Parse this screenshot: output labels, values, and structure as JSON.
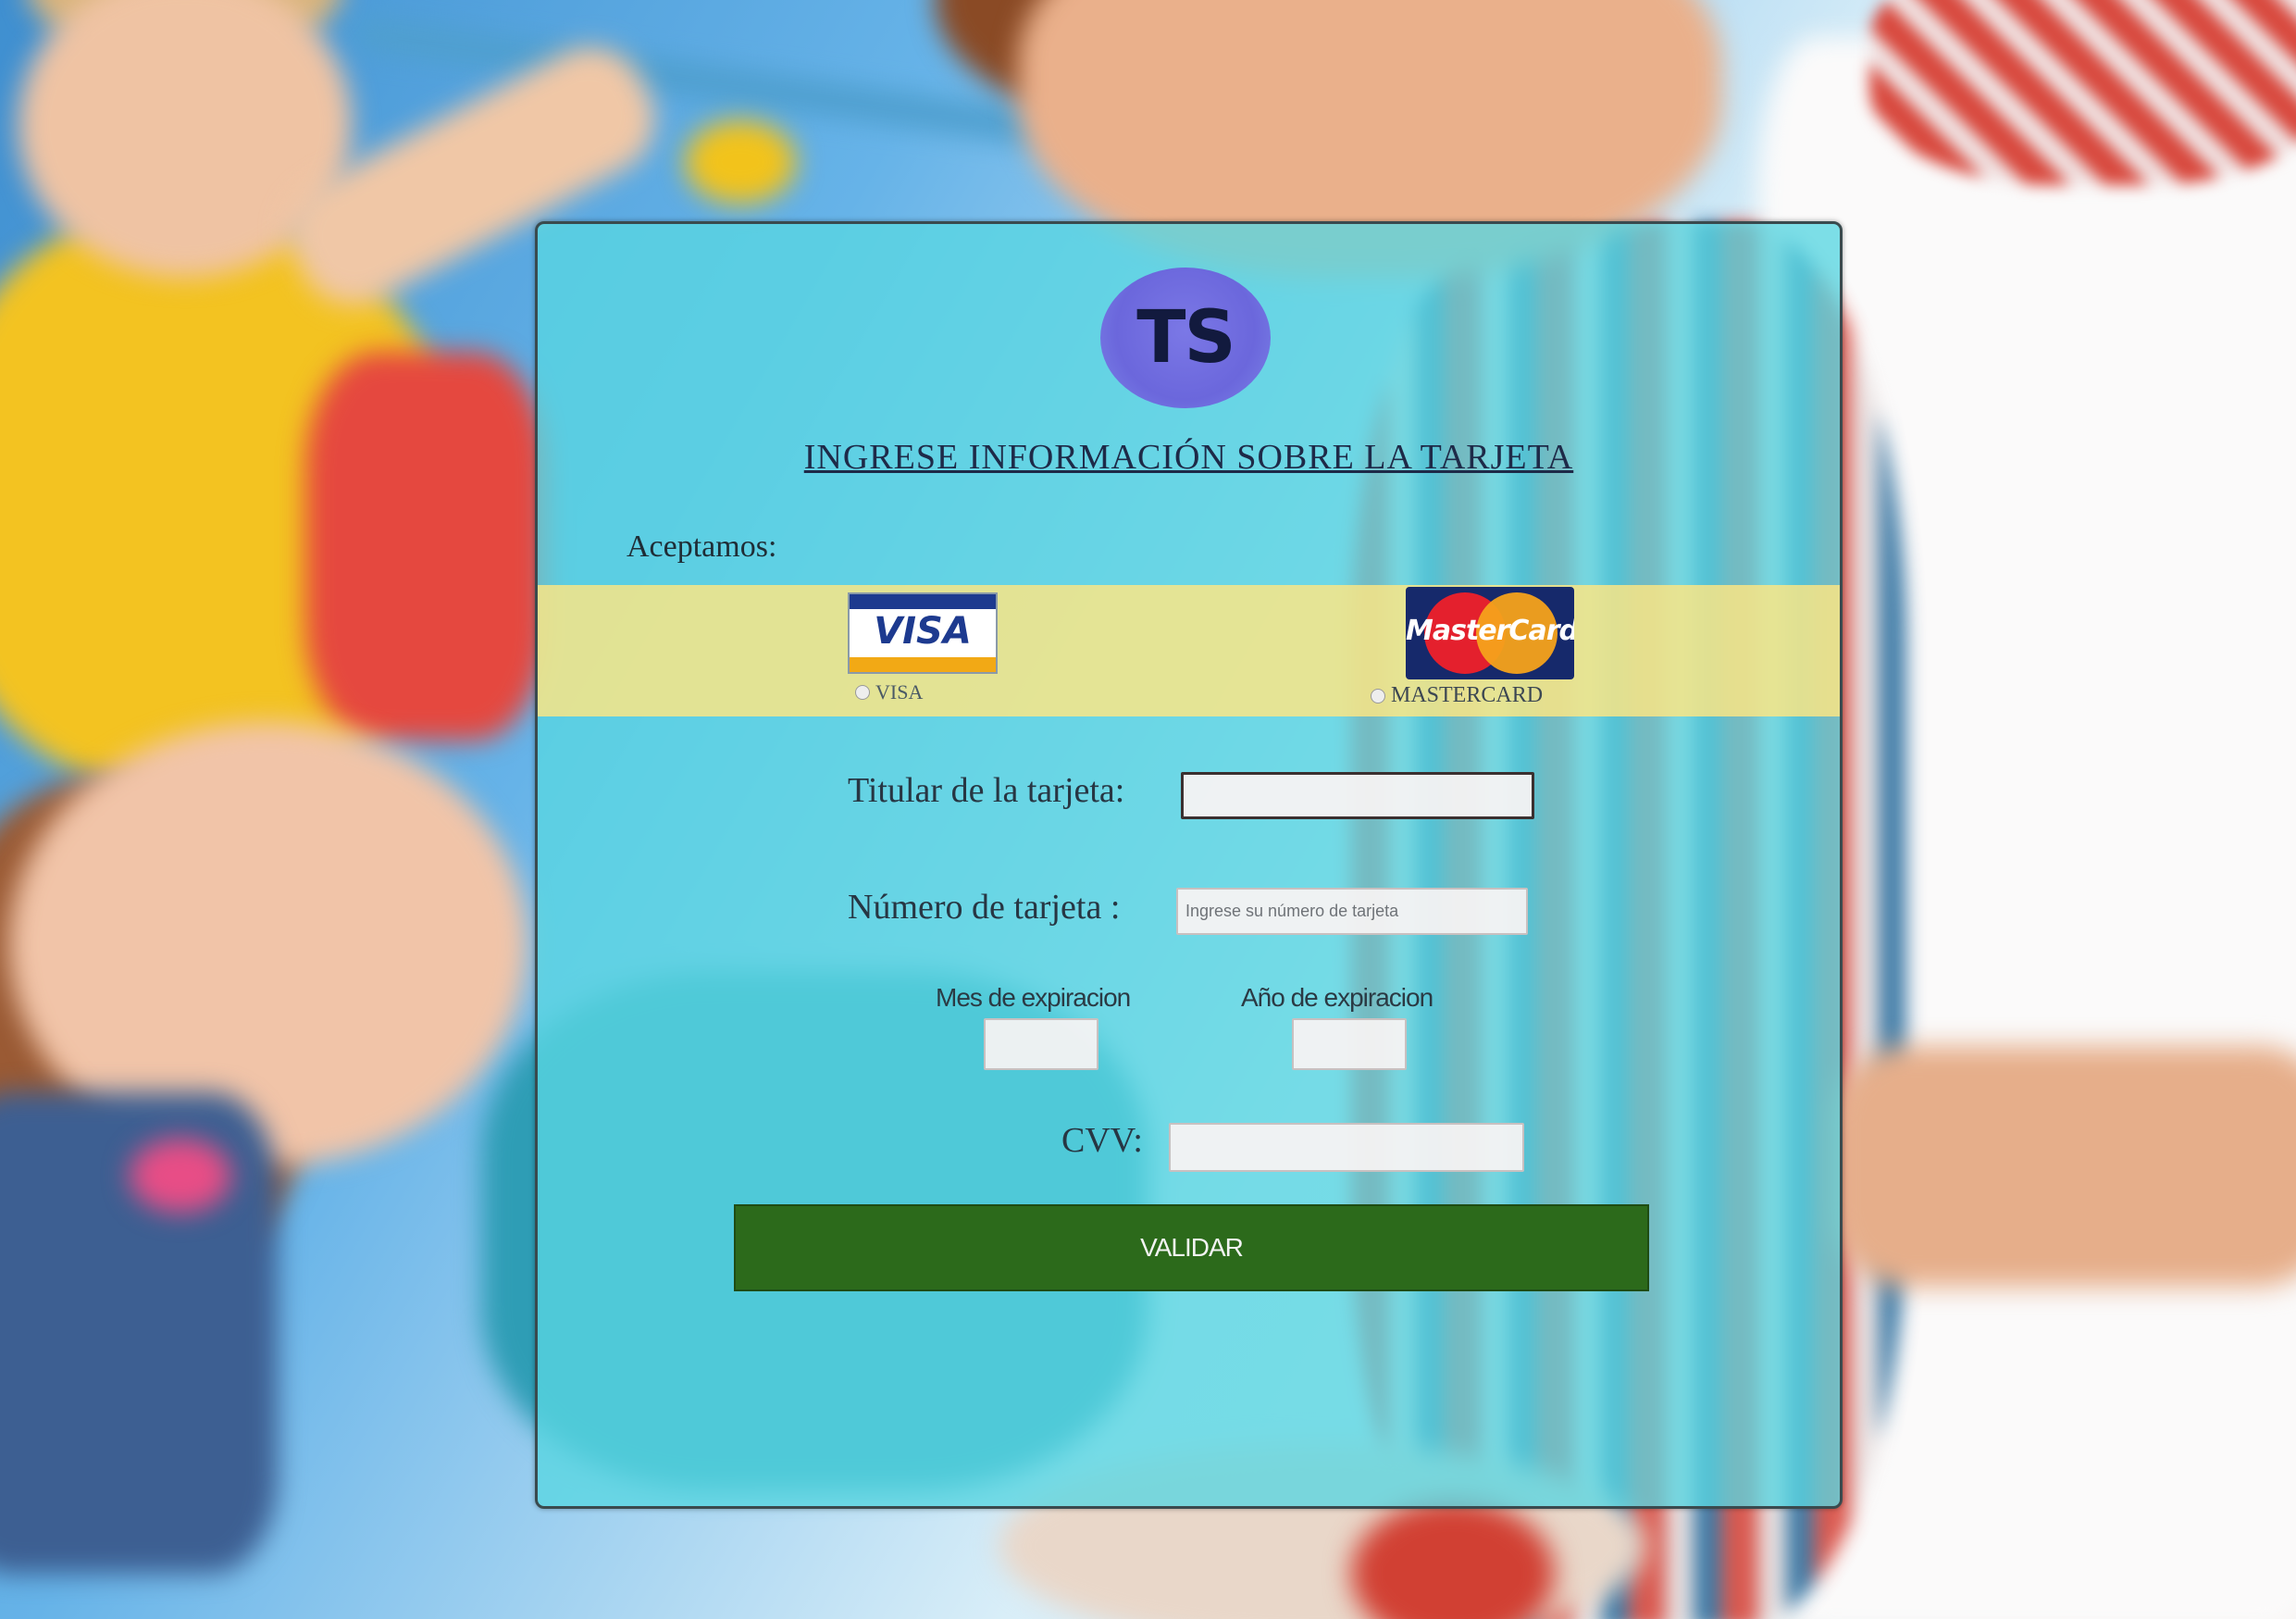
{
  "logo": {
    "text": "TS"
  },
  "form": {
    "heading": "INGRESE INFORMACIÓN SOBRE LA TARJETA",
    "accept_label": "Aceptamos:",
    "brands": {
      "visa_logo_text": "VISA",
      "visa_label": "VISA",
      "mastercard_logo_text": "MasterCard",
      "mastercard_label": "MASTERCARD"
    },
    "titular": {
      "label": "Titular de la tarjeta:",
      "value": "",
      "placeholder": ""
    },
    "numero": {
      "label": "Número de tarjeta :",
      "value": "",
      "placeholder": "Ingrese su número de tarjeta"
    },
    "mes": {
      "label": "Mes de expiracion",
      "value": ""
    },
    "anio": {
      "label": "Año de expiracion",
      "value": ""
    },
    "cvv": {
      "label": "CVV:",
      "value": ""
    },
    "submit_label": "VALIDAR"
  },
  "colors": {
    "card_overlay": "#58D6E2",
    "brand_band": "#FFE682",
    "submit_button": "#2C6A1B",
    "logo_circle": "#6B67DC"
  },
  "icons": {
    "visa": "visa-card-logo",
    "mastercard": "mastercard-card-logo",
    "brand": "ts-logo"
  }
}
